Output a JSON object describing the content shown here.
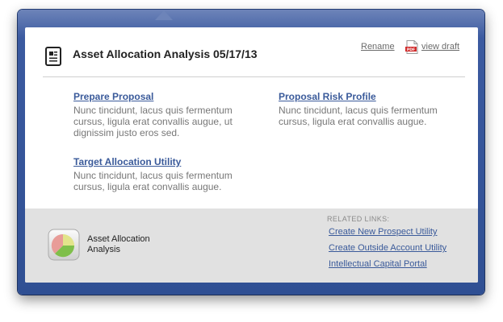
{
  "header": {
    "title": "Asset Allocation Analysis 05/17/13",
    "rename_label": "Rename",
    "view_draft_label": "view draft",
    "pdf_icon_text": "PDF"
  },
  "items": [
    {
      "title": "Prepare Proposal",
      "description": "Nunc tincidunt, lacus quis fermentum cursus, ligula erat convallis augue, ut dignissim justo eros sed."
    },
    {
      "title": "Proposal Risk Profile",
      "description": "Nunc tincidunt, lacus quis fermentum cursus, ligula erat convallis augue."
    },
    {
      "title": "Target Allocation Utility",
      "description": "Nunc tincidunt, lacus quis fermentum cursus, ligula erat convallis augue."
    }
  ],
  "footer": {
    "app_name_line1": "Asset Allocation",
    "app_name_line2": "Analysis",
    "related_heading": "RELATED LINKS:",
    "related_links": [
      "Create New Prospect Utility",
      "Create Outside Account Utility",
      "Intellectual Capital Portal"
    ]
  },
  "colors": {
    "frame": "#2f4f93",
    "link": "#3a5a9a",
    "footer_bg": "#e1e1e1"
  },
  "icons": {
    "document": "document-icon",
    "pdf": "pdf-icon",
    "app": "pie-chart-app-icon"
  }
}
